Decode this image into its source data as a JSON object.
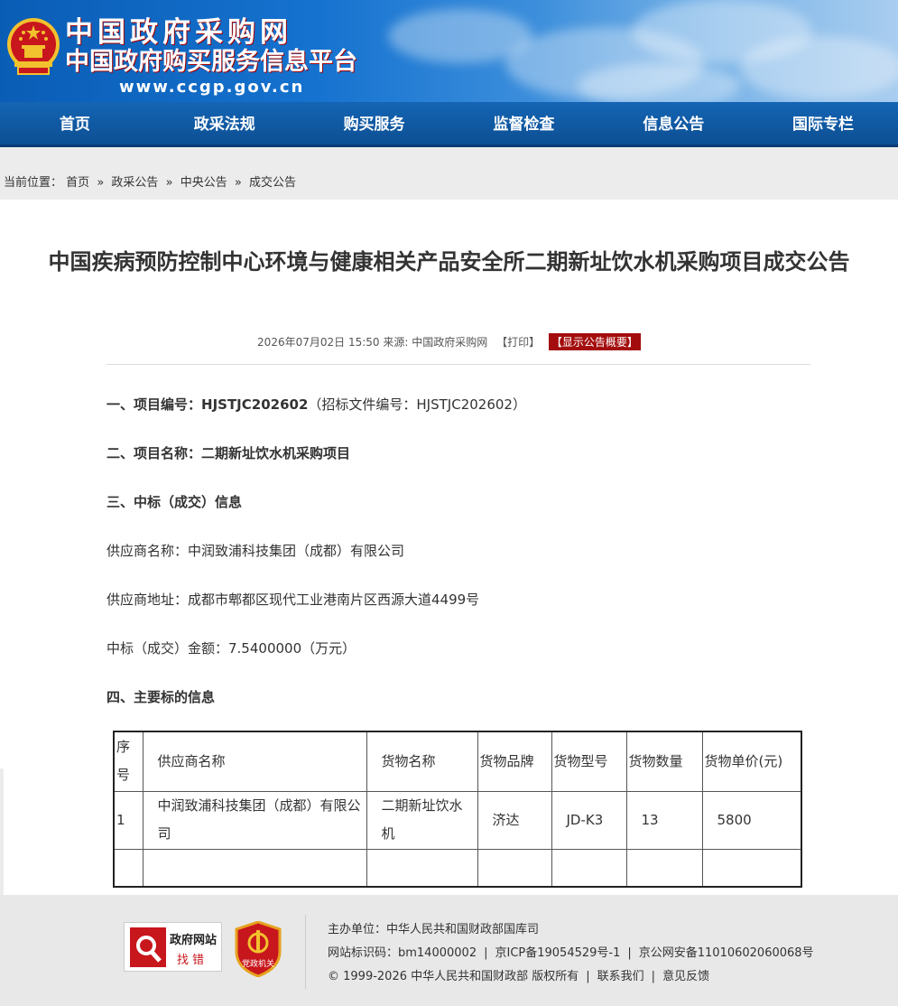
{
  "header": {
    "title_line1": "中国政府采购网",
    "title_line2": "中国政府购买服务信息平台",
    "url": "www.ccgp.gov.cn"
  },
  "nav": [
    "首页",
    "政采法规",
    "购买服务",
    "监督检查",
    "信息公告",
    "国际专栏"
  ],
  "breadcrumb": {
    "label": "当前位置：",
    "items": [
      "首页",
      "政采公告",
      "中央公告",
      "成交公告"
    ],
    "separator": "»"
  },
  "article": {
    "title": "中国疾病预防控制中心环境与健康相关产品安全所二期新址饮水机采购项目成交公告",
    "meta": {
      "date": "2026年07月02日 15:50",
      "source_label": "来源:",
      "source": "中国政府采购网",
      "print": "【打印】",
      "summary": "【显示公告概要】"
    },
    "project_no_label": "一、项目编号：",
    "project_no": "HJSTJC202602",
    "tender_no_text": "（招标文件编号：HJSTJC202602）",
    "project_name_label": "二、项目名称：",
    "project_name": "二期新址饮水机采购项目",
    "section3": "三、中标（成交）信息",
    "supplier_name": "供应商名称：中润致浦科技集团（成都）有限公司",
    "supplier_address": "供应商地址：成都市郫都区现代工业港南片区西源大道4499号",
    "amount": "中标（成交）金额：7.5400000（万元）",
    "section4": "四、主要标的信息",
    "table": {
      "headers": [
        "序号",
        "供应商名称",
        "货物名称",
        "货物品牌",
        "货物型号",
        "货物数量",
        "货物单价(元)"
      ],
      "rows": [
        [
          "1",
          "中润致浦科技集团（成都）有限公司",
          "二期新址饮水机",
          "济达",
          "JD-K3",
          "13",
          "5800"
        ]
      ]
    }
  },
  "footer": {
    "badge_text1": "政府网站",
    "badge_text2": "找错",
    "badge2_text": "党政机关",
    "sponsor": "主办单位：中华人民共和国财政部国库司",
    "site_id": "网站标识码：bm14000002",
    "icp": "京ICP备19054529号-1",
    "police": "京公网安备11010602060068号",
    "copyright": "© 1999-2026 中华人民共和国财政部 版权所有",
    "contact": "联系我们",
    "feedback": "意见反馈"
  },
  "colors": {
    "nav_bg": "#0d4f93",
    "summary_bg": "#a30d0d",
    "emblem_red": "#c8161d",
    "emblem_gold": "#f2c12e"
  }
}
